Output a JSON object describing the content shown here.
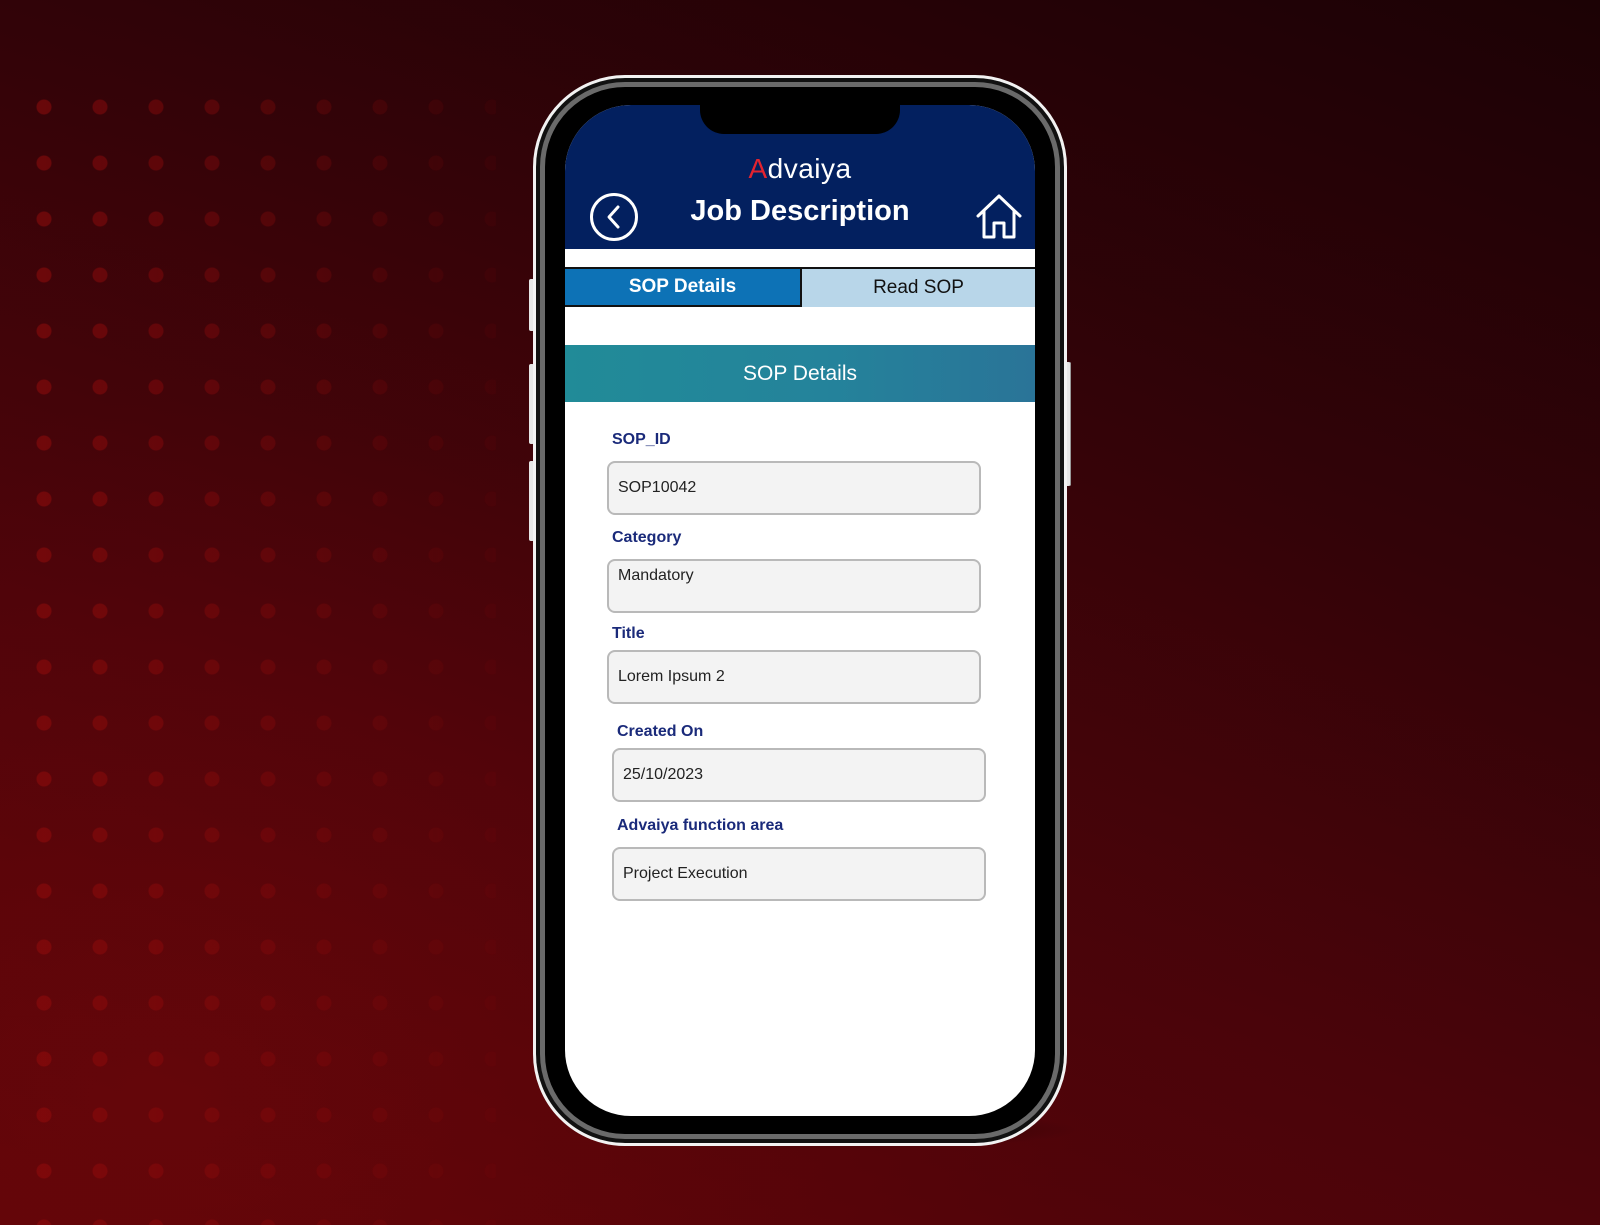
{
  "app": {
    "brand": {
      "prefix": "",
      "accent_glyph": "A",
      "rest": "dvaiya"
    },
    "page_title": "Job Description",
    "back_icon": "chevron-left-circle-icon",
    "home_icon": "home-icon"
  },
  "tabs": [
    {
      "label": "SOP Details",
      "active": true
    },
    {
      "label": "Read SOP",
      "active": false
    }
  ],
  "section": {
    "title": "SOP Details"
  },
  "form": {
    "fields": [
      {
        "label": "SOP_ID",
        "value": "SOP10042"
      },
      {
        "label": "Category",
        "value": "Mandatory"
      },
      {
        "label": "Title",
        "value": "Lorem Ipsum 2"
      },
      {
        "label": "Created On",
        "value": "25/10/2023"
      },
      {
        "label": "Advaiya function area",
        "value": "Project Execution"
      }
    ]
  },
  "colors": {
    "header_bg": "#03205f",
    "brand_accent": "#e3232f",
    "tab_active": "#0d72b6",
    "tab_inactive": "#b8d6e9",
    "banner": "#218b98",
    "label_text": "#1a2a7a",
    "background": "#4a040a"
  }
}
